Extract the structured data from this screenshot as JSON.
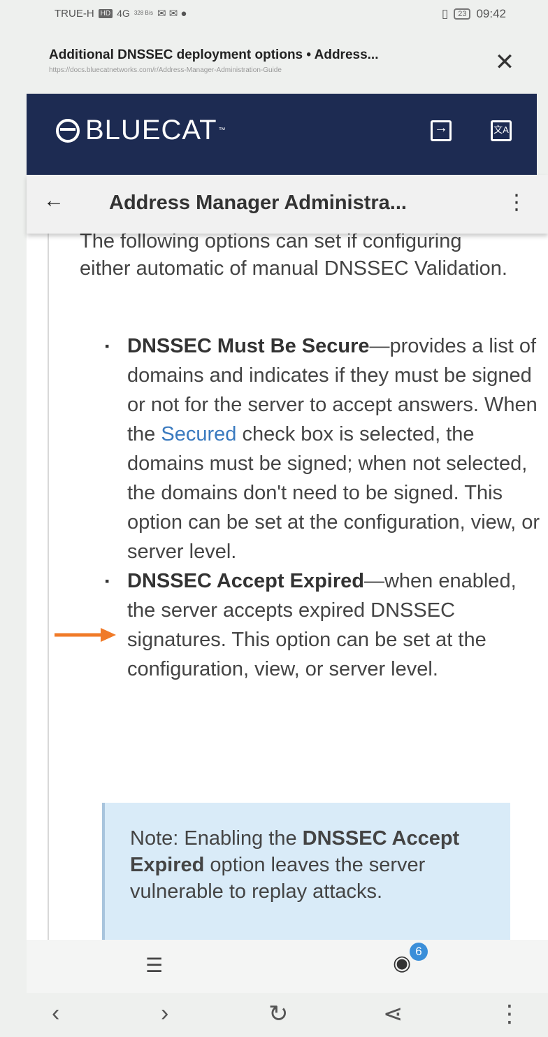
{
  "status_bar": {
    "carrier": "TRUE-H",
    "net_badge": "HD",
    "signal": "4G",
    "speed": "328 B/s",
    "battery": "23",
    "time": "09:42"
  },
  "url_bar": {
    "title": "Additional DNSSEC deployment options • Address...",
    "url": "https://docs.bluecatnetworks.com/r/Address-Manager-Administration-Guide",
    "close_glyph": "✕"
  },
  "app_header": {
    "logo_text": "BLUECAT",
    "logo_tm": "™"
  },
  "breadcrumb": {
    "back_glyph": "←",
    "title": "Address Manager Administra...",
    "menu_glyph": "⋮"
  },
  "content": {
    "intro": "The following options can set if configuring either automatic of manual DNSSEC Validation.",
    "bullet1": {
      "term": "DNSSEC Must Be Secure",
      "text_a": "—provides a list of domains and indicates if they must be signed or not for the server to accept answers. When the ",
      "link": "Secured",
      "text_b": " check box is selected, the domains must be signed; when not selected, the domains don't need to be signed. This option can be set at the configuration, view, or server level."
    },
    "bullet2": {
      "term": "DNSSEC Accept Expired",
      "text": "—when enabled, the server accepts expired DNSSEC signatures. This option can be set at the configuration, view, or server level."
    },
    "note": {
      "prefix": "Note: Enabling the ",
      "term": "DNSSEC Accept Expired",
      "suffix": " option leaves the server vulnerable to replay attacks."
    }
  },
  "toolbar": {
    "toc_glyph": "☰",
    "eye_glyph": "◉",
    "badge_count": "6"
  },
  "nav": {
    "back": "‹",
    "forward": "›",
    "reload": "↻",
    "share": "⋖",
    "more": "⋮"
  },
  "colors": {
    "header_bg": "#1d2b52",
    "link": "#3a7abf",
    "note_bg": "#d9ebf8",
    "arrow": "#f07a28"
  }
}
